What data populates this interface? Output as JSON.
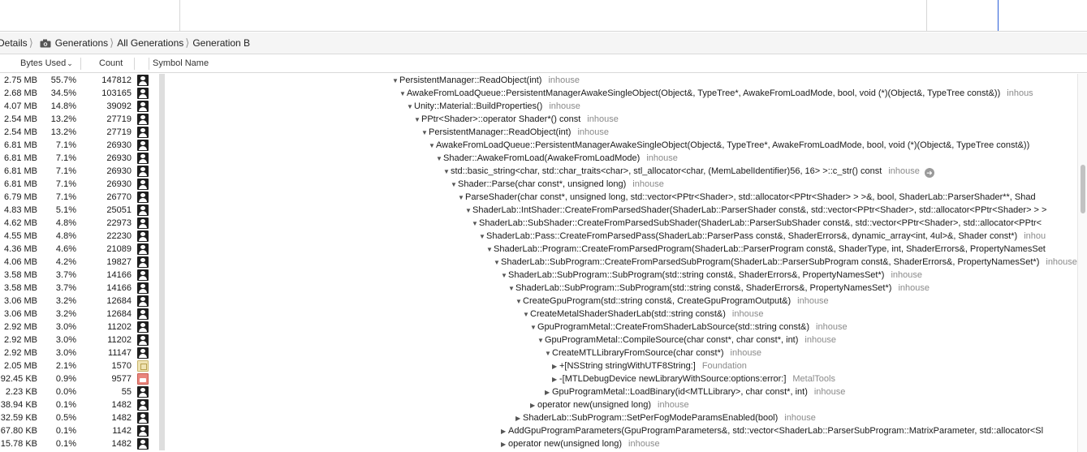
{
  "breadcrumb": {
    "items": [
      {
        "label": "Details",
        "icon": ""
      },
      {
        "label": "Generations",
        "icon": "camera-icon"
      },
      {
        "label": "All Generations",
        "icon": ""
      },
      {
        "label": "Generation B",
        "icon": ""
      }
    ]
  },
  "columns": {
    "bytes_used": "Bytes Used",
    "sort_indicator": "⌄",
    "count": "Count",
    "symbol_name": "Symbol Name"
  },
  "colors": {
    "selection_blue": "#2b5fd9",
    "library_gray": "#8a8a8a"
  },
  "rows": [
    {
      "bytes": "2.75 MB",
      "pct": "55.7%",
      "count": "147812",
      "icon": "user",
      "depth": 0,
      "expand": "▼",
      "symbol": "PersistentManager::ReadObject(int)",
      "lib": "inhouse",
      "goto": ""
    },
    {
      "bytes": "2.68 MB",
      "pct": "34.5%",
      "count": "103165",
      "icon": "user",
      "depth": 1,
      "expand": "▼",
      "symbol": "AwakeFromLoadQueue::PersistentManagerAwakeSingleObject(Object&, TypeTree*, AwakeFromLoadMode, bool, void (*)(Object&, TypeTree const&))",
      "lib": "inhous",
      "goto": ""
    },
    {
      "bytes": "4.07 MB",
      "pct": "14.8%",
      "count": "39092",
      "icon": "user",
      "depth": 2,
      "expand": "▼",
      "symbol": "Unity::Material::BuildProperties()",
      "lib": "inhouse",
      "goto": ""
    },
    {
      "bytes": "2.54 MB",
      "pct": "13.2%",
      "count": "27719",
      "icon": "user",
      "depth": 3,
      "expand": "▼",
      "symbol": "PPtr<Shader>::operator Shader*() const",
      "lib": "inhouse",
      "goto": ""
    },
    {
      "bytes": "2.54 MB",
      "pct": "13.2%",
      "count": "27719",
      "icon": "user",
      "depth": 4,
      "expand": "▼",
      "symbol": "PersistentManager::ReadObject(int)",
      "lib": "inhouse",
      "goto": ""
    },
    {
      "bytes": "6.81 MB",
      "pct": "7.1%",
      "count": "26930",
      "icon": "user",
      "depth": 5,
      "expand": "▼",
      "symbol": "AwakeFromLoadQueue::PersistentManagerAwakeSingleObject(Object&, TypeTree*, AwakeFromLoadMode, bool, void (*)(Object&, TypeTree const&))",
      "lib": "",
      "goto": ""
    },
    {
      "bytes": "6.81 MB",
      "pct": "7.1%",
      "count": "26930",
      "icon": "user",
      "depth": 6,
      "expand": "▼",
      "symbol": "Shader::AwakeFromLoad(AwakeFromLoadMode)",
      "lib": "inhouse",
      "goto": ""
    },
    {
      "bytes": "6.81 MB",
      "pct": "7.1%",
      "count": "26930",
      "icon": "user",
      "depth": 7,
      "expand": "▼",
      "symbol": "std::basic_string<char, std::char_traits<char>, stl_allocator<char, (MemLabelIdentifier)56, 16> >::c_str() const",
      "lib": "inhouse",
      "goto": "➜"
    },
    {
      "bytes": "6.81 MB",
      "pct": "7.1%",
      "count": "26930",
      "icon": "user",
      "depth": 8,
      "expand": "▼",
      "symbol": "Shader::Parse(char const*, unsigned long)",
      "lib": "inhouse",
      "goto": ""
    },
    {
      "bytes": "6.79 MB",
      "pct": "7.1%",
      "count": "26770",
      "icon": "user",
      "depth": 9,
      "expand": "▼",
      "symbol": "ParseShader(char const*, unsigned long, std::vector<PPtr<Shader>, std::allocator<PPtr<Shader> > >&, bool, ShaderLab::ParserShader**, Shad",
      "lib": "",
      "goto": ""
    },
    {
      "bytes": "4.83 MB",
      "pct": "5.1%",
      "count": "25051",
      "icon": "user",
      "depth": 10,
      "expand": "▼",
      "symbol": "ShaderLab::IntShader::CreateFromParsedShader(ShaderLab::ParserShader const&, std::vector<PPtr<Shader>, std::allocator<PPtr<Shader> > >",
      "lib": "",
      "goto": ""
    },
    {
      "bytes": "4.62 MB",
      "pct": "4.8%",
      "count": "22973",
      "icon": "user",
      "depth": 11,
      "expand": "▼",
      "symbol": "ShaderLab::SubShader::CreateFromParsedSubShader(ShaderLab::ParserSubShader const&, std::vector<PPtr<Shader>, std::allocator<PPtr<",
      "lib": "",
      "goto": ""
    },
    {
      "bytes": "4.55 MB",
      "pct": "4.8%",
      "count": "22230",
      "icon": "user",
      "depth": 12,
      "expand": "▼",
      "symbol": "ShaderLab::Pass::CreateFromParsedPass(ShaderLab::ParserPass const&, ShaderErrors&, dynamic_array<int, 4ul>&, Shader const*)",
      "lib": "inhou",
      "goto": ""
    },
    {
      "bytes": "4.36 MB",
      "pct": "4.6%",
      "count": "21089",
      "icon": "user",
      "depth": 13,
      "expand": "▼",
      "symbol": "ShaderLab::Program::CreateFromParsedProgram(ShaderLab::ParserProgram const&, ShaderType, int, ShaderErrors&, PropertyNamesSet",
      "lib": "",
      "goto": ""
    },
    {
      "bytes": "4.06 MB",
      "pct": "4.2%",
      "count": "19827",
      "icon": "user",
      "depth": 14,
      "expand": "▼",
      "symbol": "ShaderLab::SubProgram::CreateFromParsedSubProgram(ShaderLab::ParserSubProgram const&, ShaderErrors&, PropertyNamesSet*)",
      "lib": "inhouse",
      "goto": ""
    },
    {
      "bytes": "3.58 MB",
      "pct": "3.7%",
      "count": "14166",
      "icon": "user",
      "depth": 15,
      "expand": "▼",
      "symbol": "ShaderLab::SubProgram::SubProgram(std::string const&, ShaderErrors&, PropertyNamesSet*)",
      "lib": "inhouse",
      "goto": ""
    },
    {
      "bytes": "3.58 MB",
      "pct": "3.7%",
      "count": "14166",
      "icon": "user",
      "depth": 16,
      "expand": "▼",
      "symbol": "ShaderLab::SubProgram::SubProgram(std::string const&, ShaderErrors&, PropertyNamesSet*)",
      "lib": "inhouse",
      "goto": ""
    },
    {
      "bytes": "3.06 MB",
      "pct": "3.2%",
      "count": "12684",
      "icon": "user",
      "depth": 17,
      "expand": "▼",
      "symbol": "CreateGpuProgram(std::string const&, CreateGpuProgramOutput&)",
      "lib": "inhouse",
      "goto": ""
    },
    {
      "bytes": "3.06 MB",
      "pct": "3.2%",
      "count": "12684",
      "icon": "user",
      "depth": 18,
      "expand": "▼",
      "symbol": "CreateMetalShaderShaderLab(std::string const&)",
      "lib": "inhouse",
      "goto": ""
    },
    {
      "bytes": "2.92 MB",
      "pct": "3.0%",
      "count": "11202",
      "icon": "user",
      "depth": 19,
      "expand": "▼",
      "symbol": "GpuProgramMetal::CreateFromShaderLabSource(std::string const&)",
      "lib": "inhouse",
      "goto": ""
    },
    {
      "bytes": "2.92 MB",
      "pct": "3.0%",
      "count": "11202",
      "icon": "user",
      "depth": 20,
      "expand": "▼",
      "symbol": "GpuProgramMetal::CompileSource(char const*, char const*, int)",
      "lib": "inhouse",
      "goto": ""
    },
    {
      "bytes": "2.92 MB",
      "pct": "3.0%",
      "count": "11147",
      "icon": "user",
      "depth": 21,
      "expand": "▼",
      "symbol": "CreateMTLLibraryFromSource(char const*)",
      "lib": "inhouse",
      "goto": ""
    },
    {
      "bytes": "2.05 MB",
      "pct": "2.1%",
      "count": "1570",
      "icon": "framework",
      "depth": 22,
      "expand": "▶",
      "symbol": "+[NSString stringWithUTF8String:]",
      "lib": "Foundation",
      "goto": ""
    },
    {
      "bytes": "92.45 KB",
      "pct": "0.9%",
      "count": "9577",
      "icon": "tools",
      "depth": 22,
      "expand": "▶",
      "symbol": "-[MTLDebugDevice newLibraryWithSource:options:error:]",
      "lib": "MetalTools",
      "goto": ""
    },
    {
      "bytes": "2.23 KB",
      "pct": "0.0%",
      "count": "55",
      "icon": "user",
      "depth": 21,
      "expand": "▶",
      "symbol": "GpuProgramMetal::LoadBinary(id<MTLLibrary>, char const*, int)",
      "lib": "inhouse",
      "goto": ""
    },
    {
      "bytes": "38.94 KB",
      "pct": "0.1%",
      "count": "1482",
      "icon": "user",
      "depth": 19,
      "expand": "▶",
      "symbol": "operator new(unsigned long)",
      "lib": "inhouse",
      "goto": ""
    },
    {
      "bytes": "32.59 KB",
      "pct": "0.5%",
      "count": "1482",
      "icon": "user",
      "depth": 17,
      "expand": "▶",
      "symbol": "ShaderLab::SubProgram::SetPerFogModeParamsEnabled(bool)",
      "lib": "inhouse",
      "goto": ""
    },
    {
      "bytes": "67.80 KB",
      "pct": "0.1%",
      "count": "1142",
      "icon": "user",
      "depth": 15,
      "expand": "▶",
      "symbol": "AddGpuProgramParameters(GpuProgramParameters&, std::vector<ShaderLab::ParserSubProgram::MatrixParameter, std::allocator<Sl",
      "lib": "",
      "goto": ""
    },
    {
      "bytes": "15.78 KB",
      "pct": "0.1%",
      "count": "1482",
      "icon": "user",
      "depth": 15,
      "expand": "▶",
      "symbol": "operator new(unsigned long)",
      "lib": "inhouse",
      "goto": ""
    }
  ]
}
